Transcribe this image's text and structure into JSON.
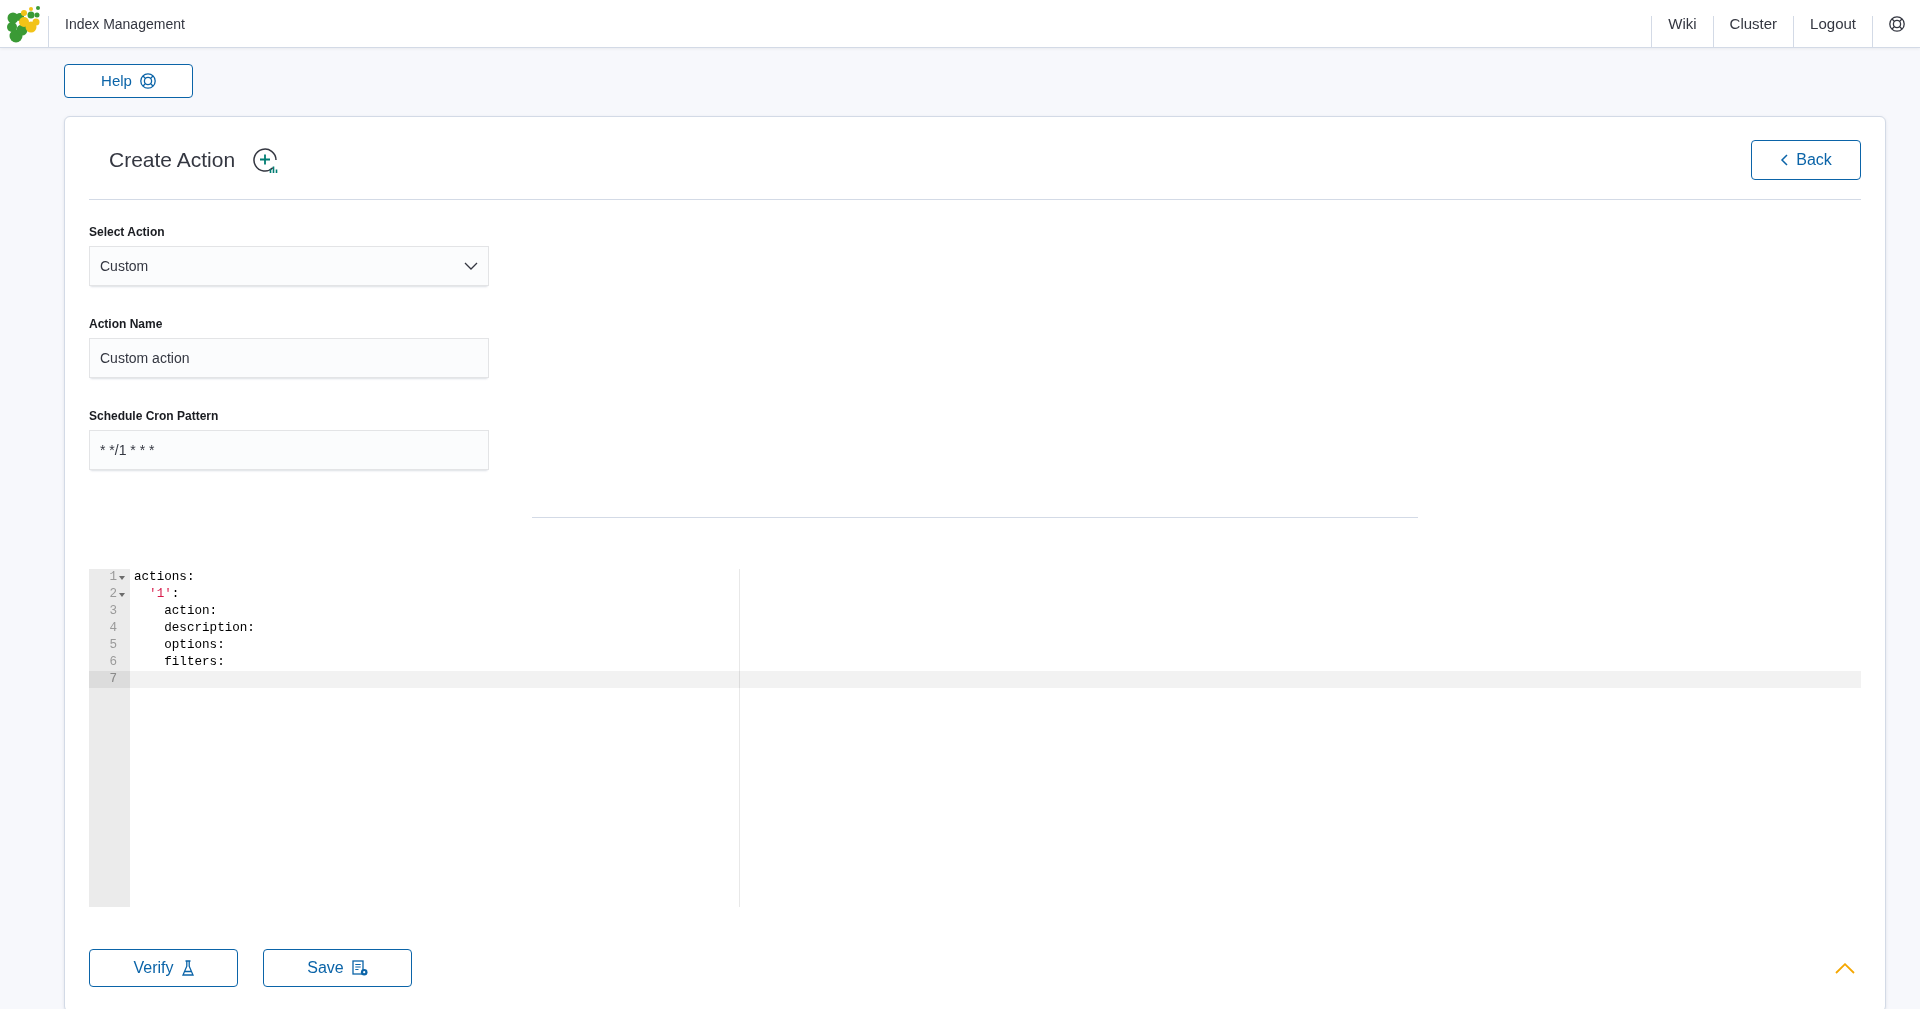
{
  "header": {
    "title": "Index Management",
    "nav": [
      "Wiki",
      "Cluster",
      "Logout"
    ]
  },
  "help_button": {
    "label": "Help"
  },
  "panel": {
    "title": "Create Action",
    "back_button": "Back",
    "fields": [
      {
        "kind": "select",
        "label": "Select Action",
        "value": "Custom"
      },
      {
        "kind": "input",
        "label": "Action Name",
        "value": "Custom action"
      },
      {
        "kind": "input",
        "label": "Schedule Cron Pattern",
        "value": "* */1 * * *"
      }
    ],
    "editor": {
      "lines": [
        {
          "number": "1",
          "foldable": true,
          "active": false,
          "tokens": [
            {
              "text": "actions:",
              "kind": "plain"
            }
          ]
        },
        {
          "number": "2",
          "foldable": true,
          "active": false,
          "tokens": [
            {
              "text": "  '1'",
              "kind": "string"
            },
            {
              "text": ":",
              "kind": "plain"
            }
          ]
        },
        {
          "number": "3",
          "foldable": false,
          "active": false,
          "tokens": [
            {
              "text": "    action:",
              "kind": "plain"
            }
          ]
        },
        {
          "number": "4",
          "foldable": false,
          "active": false,
          "tokens": [
            {
              "text": "    description:",
              "kind": "plain"
            }
          ]
        },
        {
          "number": "5",
          "foldable": false,
          "active": false,
          "tokens": [
            {
              "text": "    options:",
              "kind": "plain"
            }
          ]
        },
        {
          "number": "6",
          "foldable": false,
          "active": false,
          "tokens": [
            {
              "text": "    filters:",
              "kind": "plain"
            }
          ]
        },
        {
          "number": "7",
          "foldable": false,
          "active": true
        }
      ]
    },
    "buttons": [
      {
        "kind": "verify",
        "label": "Verify"
      },
      {
        "kind": "save",
        "label": "Save"
      }
    ]
  }
}
